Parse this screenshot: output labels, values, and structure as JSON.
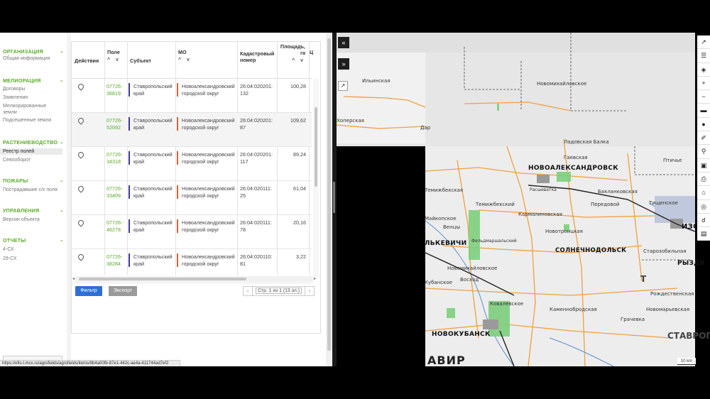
{
  "sidebar": {
    "sections": [
      {
        "title": "ОРГАНИЗАЦИЯ",
        "items": [
          "Общая информация"
        ]
      },
      {
        "title": "МЕЛИОРАЦИЯ",
        "items": [
          "Договоры",
          "Заявления",
          "Мелиорированные",
          "земли",
          "Подсешенные земли"
        ]
      },
      {
        "title": "РАСТЕНИЕВОДСТВО",
        "items": [
          "Реестр полей",
          "Севооборот"
        ]
      },
      {
        "title": "ПОЖАРЫ",
        "items": [
          "Пострадавшие с/х поля"
        ]
      },
      {
        "title": "УПРАВЛЕНИЯ",
        "items": [
          "Версии объекта"
        ]
      },
      {
        "title": "ОТЧЕТЫ",
        "items": [
          "4-СХ",
          "29-СХ"
        ]
      }
    ]
  },
  "table": {
    "headers": {
      "actions": "Действия",
      "field": "Поле",
      "subject": "Субъект",
      "mo": "МО",
      "cadastral_1": "Кадастровый",
      "cadastral_2": "номер",
      "area_1": "Площадь,",
      "area_2": "га",
      "sort": "^ v",
      "extra": "Ц"
    },
    "rows": [
      {
        "field_1": "07726-",
        "field_2": "36819",
        "subject_1": "Ставропольский",
        "subject_2": "край",
        "mo_1": "Новоалександровский",
        "mo_2": "городской округ",
        "cad_1": "26:04:020201:",
        "cad_2": "132",
        "area": "100,28"
      },
      {
        "field_1": "07726-",
        "field_2": "52092",
        "subject_1": "Ставропольский",
        "subject_2": "край",
        "mo_1": "Новоалександровский",
        "mo_2": "городской округ",
        "cad_1": "26:04:020201:",
        "cad_2": "87",
        "area": "109,62"
      },
      {
        "field_1": "07726-",
        "field_2": "34318",
        "subject_1": "Ставропольский",
        "subject_2": "край",
        "mo_1": "Новоалександровский",
        "mo_2": "городской округ",
        "cad_1": "26:04:020201:",
        "cad_2": "117",
        "area": "89,24"
      },
      {
        "field_1": "07726-",
        "field_2": "33409",
        "subject_1": "Ставропольский",
        "subject_2": "край",
        "mo_1": "Новоалександровский",
        "mo_2": "городской округ",
        "cad_1": "26:04:020111:",
        "cad_2": "25",
        "area": "61,04"
      },
      {
        "field_1": "07726-",
        "field_2": "46278",
        "subject_1": "Ставропольский",
        "subject_2": "край",
        "mo_1": "Новоалександровский",
        "mo_2": "городской округ",
        "cad_1": "26:04:020111:",
        "cad_2": "78",
        "area": "20,16"
      },
      {
        "field_1": "07726-",
        "field_2": "38284",
        "subject_1": "Ставропольский",
        "subject_2": "край",
        "mo_1": "Новоалександровский",
        "mo_2": "городской округ",
        "cad_1": "26:04:020110:",
        "cad_2": "81",
        "area": "3,22"
      }
    ]
  },
  "toolbar": {
    "filter_label": "Фильтр",
    "export_label": "Экспорт",
    "pager_prev": "‹",
    "pager_next": "›",
    "pager_text": "Стр. 1 из 1 (13 эл.)"
  },
  "statusbar": {
    "url": "https://efis-t.mcx.ru/agrofields/agrofields/items/8b4a00fb-87e1-442c-ae4a-411744ad7ef2"
  },
  "map": {
    "collapse_1": "«",
    "collapse_2": "»",
    "scale": "10 km",
    "labels": [
      "Ильинская",
      "Хоперская",
      "Новомихайловское",
      "Ладовская Балка",
      "Гаевская",
      "НОВОАЛЕКСАНДРОВСК",
      "Птичье",
      "Темижбекская",
      "Темижбекский",
      "Расшеватка",
      "Бакланковская",
      "Передовой",
      "Тищенское",
      "ИЗО",
      "Майкопское",
      "Кармалиновская",
      "Венцы",
      "Новотроицкая",
      "ЛЬКЕВИЧИ",
      "Фельдмаршальский",
      "СОЛНЕЧНОДОЛЬСК",
      "Старозобильная",
      "Новомихайловское",
      "Кубанское",
      "Восход",
      "РЫЗДВ",
      "Рождественская",
      "Новомарьевская",
      "Ковалевское",
      "НОВОКУБАНСК",
      "СТАВРОП",
      "АВИР",
      "Т",
      "Дар",
      "Каменнобродская",
      "Грачевка"
    ]
  },
  "colors": {
    "accent_green": "#5aaa28",
    "filter_blue": "#2d6fd8",
    "export_gray": "#9a9a9a",
    "subject_bar": "#3a3aa0",
    "mo_bar": "#c86a3a"
  }
}
